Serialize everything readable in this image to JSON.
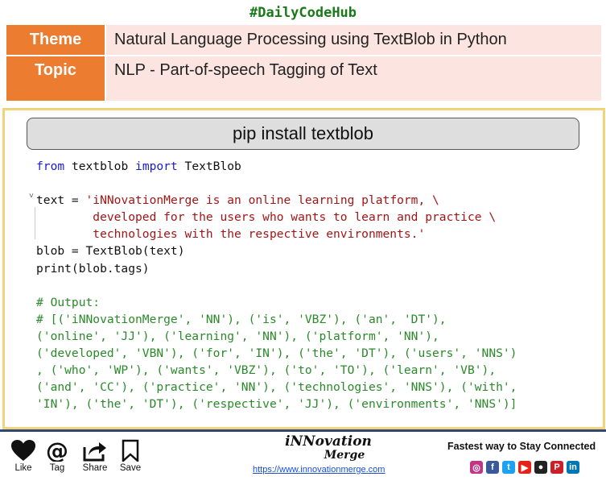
{
  "hashtag": "#DailyCodeHub",
  "header": {
    "theme_label": "Theme",
    "theme_value": "Natural Language Processing using TextBlob in Python",
    "topic_label": "Topic",
    "topic_value": "NLP - Part-of-speech Tagging of Text"
  },
  "pip_command": "pip install textblob",
  "code": {
    "l1_kw1": "from",
    "l1_mod": " textblob ",
    "l1_kw2": "import",
    "l1_cls": " TextBlob",
    "l3_pre": "text = ",
    "l3_str": "'iNNovationMerge is an online learning platform, \\",
    "l4_str": "        developed for the users who wants to learn and practice \\",
    "l5_str": "        technologies with the respective environments.'",
    "l6": "blob = TextBlob(text)",
    "l7": "print(blob.tags)",
    "c1": "# Output:",
    "c2": "# [('iNNovationMerge', 'NN'), ('is', 'VBZ'), ('an', 'DT'),",
    "c3": "('online', 'JJ'), ('learning', 'NN'), ('platform', 'NN'),",
    "c4": "('developed', 'VBN'), ('for', 'IN'), ('the', 'DT'), ('users', 'NNS')",
    "c5": ", ('who', 'WP'), ('wants', 'VBZ'), ('to', 'TO'), ('learn', 'VB'),",
    "c6": "('and', 'CC'), ('practice', 'NN'), ('technologies', 'NNS'), ('with',",
    "c7": "'IN'), ('the', 'DT'), ('respective', 'JJ'), ('environments', 'NNS')]"
  },
  "footer": {
    "like": "Like",
    "tag": "Tag",
    "share": "Share",
    "save": "Save",
    "logo_line1": "iNNovation",
    "logo_line2": "Merge",
    "url": "https://www.innovationmerge.com",
    "tagline": "Fastest way to Stay Connected",
    "social_icons": [
      "instagram-icon",
      "facebook-icon",
      "twitter-icon",
      "youtube-icon",
      "github-icon",
      "pinterest-icon",
      "linkedin-icon"
    ]
  },
  "colors": {
    "header_label_bg": "#ec7c30",
    "header_value_bg": "#fce4e0",
    "hashtag": "#1a7a1a",
    "keyword": "#1a1adc",
    "string": "#a31515",
    "comment": "#2a8a2a",
    "panel_border": "#f2d27a",
    "footer_line": "#2c4a75"
  }
}
